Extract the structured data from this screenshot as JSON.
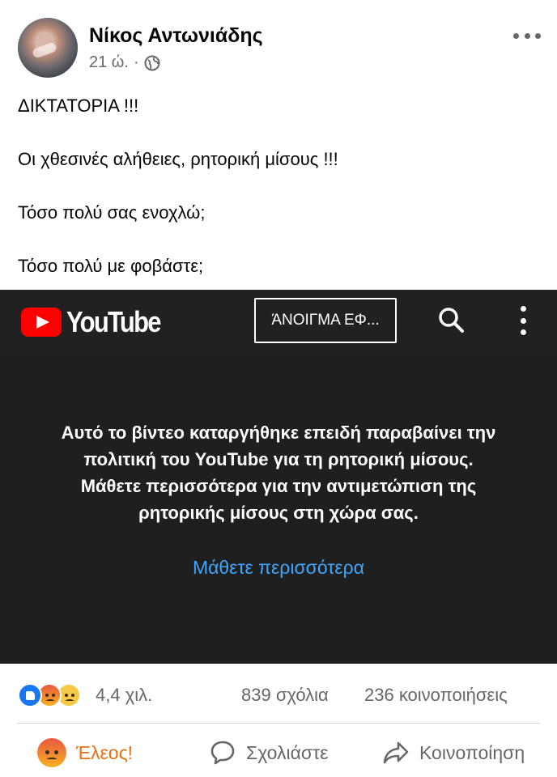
{
  "post": {
    "author": "Νίκος Αντωνιάδης",
    "time": "21 ώ.",
    "separator": "·",
    "audience_icon": "globe-icon",
    "menu_icon": "more-options-icon",
    "lines": [
      "ΔΙΚΤΑΤΟΡΙΑ !!!",
      "Οι χθεσινές αλήθειες, ρητορική μίσους !!!",
      "Τόσο πολύ σας ενοχλώ;",
      "Τόσο πολύ με φοβάστε;"
    ]
  },
  "youtube": {
    "wordmark": "YouTube",
    "open_app_label": "ΆΝΟΙΓΜΑ ΕΦ...",
    "message_lines": [
      "Αυτό το βίντεο καταργήθηκε επειδή παραβαίνει την",
      "πολιτική του YouTube για τη ρητορική μίσους.",
      "Μάθετε περισσότερα για την αντιμετώπιση της",
      "ρητορικής μίσους στη χώρα σας."
    ],
    "learn_more": "Μάθετε περισσότερα",
    "colors": {
      "brand_red": "#ff0000",
      "link_blue": "#3ea6ff",
      "bar_bg": "#212121",
      "player_bg": "#1f1f1f"
    }
  },
  "stats": {
    "reactions": [
      "like-icon",
      "angry-icon",
      "sad-icon"
    ],
    "reaction_count": "4,4 χιλ.",
    "comments": "839 σχόλια",
    "shares": "236 κοινοποιήσεις"
  },
  "actions": {
    "react_label": "Έλεος!",
    "comment_label": "Σχολιάστε",
    "share_label": "Κοινοποίηση",
    "react_color": "#e9710f"
  }
}
